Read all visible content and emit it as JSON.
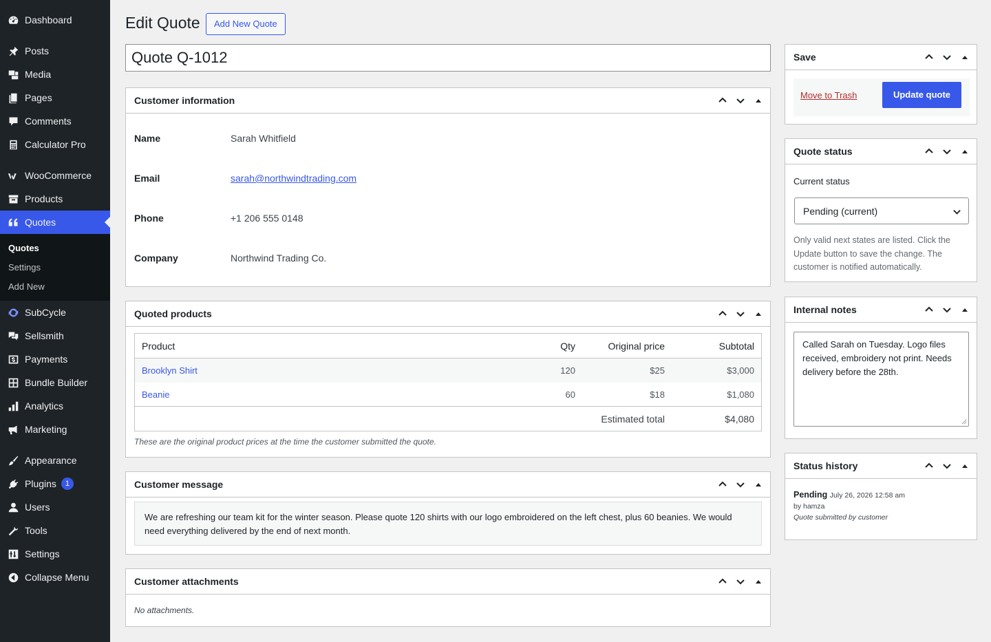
{
  "sidebar": {
    "items": [
      {
        "label": "Dashboard",
        "icon": "dashboard-icon"
      },
      {
        "label": "Posts",
        "icon": "pin-icon"
      },
      {
        "label": "Media",
        "icon": "media-icon"
      },
      {
        "label": "Pages",
        "icon": "pages-icon"
      },
      {
        "label": "Comments",
        "icon": "comment-icon"
      },
      {
        "label": "Calculator Pro",
        "icon": "calculator-icon"
      },
      {
        "label": "WooCommerce",
        "icon": "woocommerce-icon"
      },
      {
        "label": "Products",
        "icon": "archive-icon"
      },
      {
        "label": "Quotes",
        "icon": "quote-icon"
      },
      {
        "label": "SubCycle",
        "icon": "sync-icon"
      },
      {
        "label": "Sellsmith",
        "icon": "chat-icon"
      },
      {
        "label": "Payments",
        "icon": "payments-icon"
      },
      {
        "label": "Bundle Builder",
        "icon": "grid-icon"
      },
      {
        "label": "Analytics",
        "icon": "bar-chart-icon"
      },
      {
        "label": "Marketing",
        "icon": "megaphone-icon"
      },
      {
        "label": "Appearance",
        "icon": "brush-icon"
      },
      {
        "label": "Plugins",
        "icon": "plugin-icon"
      },
      {
        "label": "Users",
        "icon": "user-icon"
      },
      {
        "label": "Tools",
        "icon": "wrench-icon"
      },
      {
        "label": "Settings",
        "icon": "settings-icon"
      },
      {
        "label": "Collapse Menu",
        "icon": "collapse-icon"
      }
    ],
    "submenu": [
      "Quotes",
      "Settings",
      "Add New"
    ],
    "plugins_badge": "1"
  },
  "header": {
    "title": "Edit Quote",
    "add_new": "Add New Quote"
  },
  "post_title": "Quote Q-1012",
  "customer_info": {
    "heading": "Customer information",
    "name_label": "Name",
    "name": "Sarah Whitfield",
    "email_label": "Email",
    "email": "sarah@northwindtrading.com",
    "phone_label": "Phone",
    "phone": "+1 206 555 0148",
    "company_label": "Company",
    "company": "Northwind Trading Co."
  },
  "products": {
    "heading": "Quoted products",
    "columns": [
      "Product",
      "Qty",
      "Original price",
      "Subtotal"
    ],
    "rows": [
      {
        "product": "Brooklyn Shirt",
        "qty": "120",
        "price": "$25",
        "subtotal": "$3,000"
      },
      {
        "product": "Beanie",
        "qty": "60",
        "price": "$18",
        "subtotal": "$1,080"
      }
    ],
    "total_label": "Estimated total",
    "total": "$4,080",
    "note": "These are the original product prices at the time the customer submitted the quote."
  },
  "message": {
    "heading": "Customer message",
    "text": "We are refreshing our team kit for the winter season. Please quote 120 shirts with our logo embroidered on the left chest, plus 60 beanies. We would need everything delivered by the end of next month."
  },
  "attachments": {
    "heading": "Customer attachments",
    "empty": "No attachments."
  },
  "save": {
    "heading": "Save",
    "trash": "Move to Trash",
    "update": "Update quote"
  },
  "status": {
    "heading": "Quote status",
    "label": "Current status",
    "value": "Pending (current)",
    "help": "Only valid next states are listed. Click the Update button to save the change. The customer is notified automatically."
  },
  "notes": {
    "heading": "Internal notes",
    "text": "Called Sarah on Tuesday. Logo files received, embroidery not print. Needs delivery before the 28th."
  },
  "history": {
    "heading": "Status history",
    "status": "Pending",
    "date": "July 26, 2026 12:58 am",
    "by": "by hamza",
    "note": "Quote submitted by customer"
  },
  "colors": {
    "accent": "#3858e9",
    "sidebar": "#1d2327",
    "trash": "#b32d2e"
  }
}
